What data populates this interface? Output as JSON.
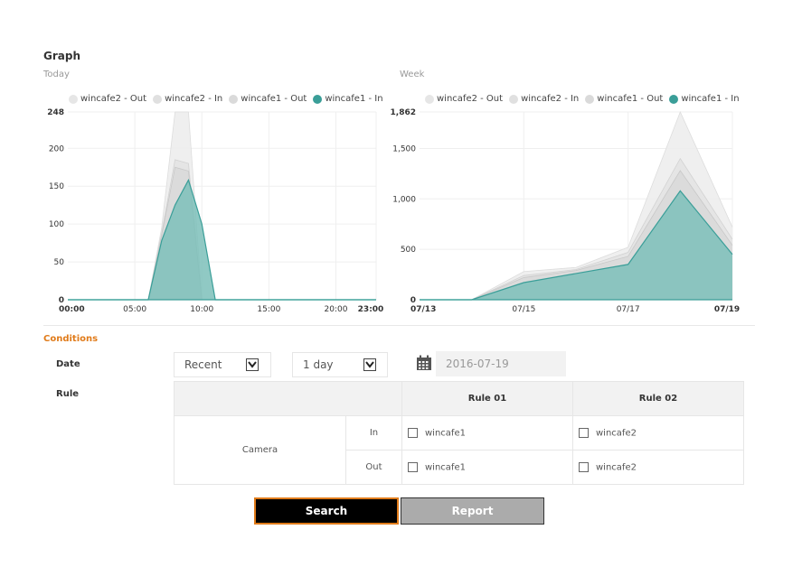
{
  "graph": {
    "title": "Graph",
    "today_label": "Today",
    "week_label": "Week",
    "legend": [
      {
        "label": "wincafe2 - Out",
        "color": "#e6e6e6"
      },
      {
        "label": "wincafe2 - In",
        "color": "#e0e0e0"
      },
      {
        "label": "wincafe1 - Out",
        "color": "#dadada"
      },
      {
        "label": "wincafe1 - In",
        "color": "#3a9e98"
      }
    ]
  },
  "chart_data": [
    {
      "type": "area",
      "title": "Today",
      "xlabel": "",
      "ylabel": "",
      "x_ticks": [
        "00:00",
        "05:00",
        "10:00",
        "15:00",
        "20:00",
        "23:00"
      ],
      "y_ticks": [
        "0",
        "50",
        "100",
        "150",
        "200",
        "248"
      ],
      "ylim": [
        0,
        248
      ],
      "x": [
        "00:00",
        "01:00",
        "02:00",
        "03:00",
        "04:00",
        "05:00",
        "06:00",
        "07:00",
        "08:00",
        "09:00",
        "10:00",
        "11:00",
        "12:00",
        "13:00",
        "14:00",
        "15:00",
        "16:00",
        "17:00",
        "18:00",
        "19:00",
        "20:00",
        "21:00",
        "22:00",
        "23:00"
      ],
      "series": [
        {
          "name": "wincafe2 - Out",
          "values": [
            0,
            0,
            0,
            0,
            0,
            0,
            0,
            95,
            248,
            248,
            0,
            0,
            0,
            0,
            0,
            0,
            0,
            0,
            0,
            0,
            0,
            0,
            0,
            0
          ]
        },
        {
          "name": "wincafe2 - In",
          "values": [
            0,
            0,
            0,
            0,
            0,
            0,
            0,
            88,
            185,
            180,
            0,
            0,
            0,
            0,
            0,
            0,
            0,
            0,
            0,
            0,
            0,
            0,
            0,
            0
          ]
        },
        {
          "name": "wincafe1 - Out",
          "values": [
            0,
            0,
            0,
            0,
            0,
            0,
            0,
            85,
            175,
            170,
            0,
            0,
            0,
            0,
            0,
            0,
            0,
            0,
            0,
            0,
            0,
            0,
            0,
            0
          ]
        },
        {
          "name": "wincafe1 - In",
          "values": [
            0,
            0,
            0,
            0,
            0,
            0,
            0,
            78,
            125,
            158,
            100,
            0,
            0,
            0,
            0,
            0,
            0,
            0,
            0,
            0,
            0,
            0,
            0,
            0
          ]
        }
      ],
      "grid": true
    },
    {
      "type": "area",
      "title": "Week",
      "xlabel": "",
      "ylabel": "",
      "x_ticks": [
        "07/13",
        "07/15",
        "07/17",
        "07/19"
      ],
      "y_ticks": [
        "0",
        "500",
        "1,000",
        "1,500",
        "1,862"
      ],
      "ylim": [
        0,
        1862
      ],
      "x": [
        "07/13",
        "07/14",
        "07/15",
        "07/16",
        "07/17",
        "07/18",
        "07/19"
      ],
      "series": [
        {
          "name": "wincafe2 - Out",
          "values": [
            0,
            0,
            280,
            320,
            520,
            1862,
            720
          ]
        },
        {
          "name": "wincafe2 - In",
          "values": [
            0,
            0,
            240,
            300,
            470,
            1400,
            600
          ]
        },
        {
          "name": "wincafe1 - Out",
          "values": [
            0,
            0,
            220,
            290,
            430,
            1280,
            540
          ]
        },
        {
          "name": "wincafe1 - In",
          "values": [
            0,
            0,
            170,
            260,
            350,
            1080,
            450
          ]
        }
      ],
      "grid": true
    }
  ],
  "conditions": {
    "title": "Conditions",
    "date_label": "Date",
    "rule_label": "Rule",
    "period_select": "Recent",
    "range_select": "1 day",
    "date_value": "2016-07-19"
  },
  "rules_table": {
    "headers": [
      "Rule 01",
      "Rule 02"
    ],
    "camera_label": "Camera",
    "rows": [
      {
        "dir": "In",
        "rule01": "wincafe1",
        "rule02": "wincafe2"
      },
      {
        "dir": "Out",
        "rule01": "wincafe1",
        "rule02": "wincafe2"
      }
    ]
  },
  "buttons": {
    "search": "Search",
    "report": "Report"
  }
}
